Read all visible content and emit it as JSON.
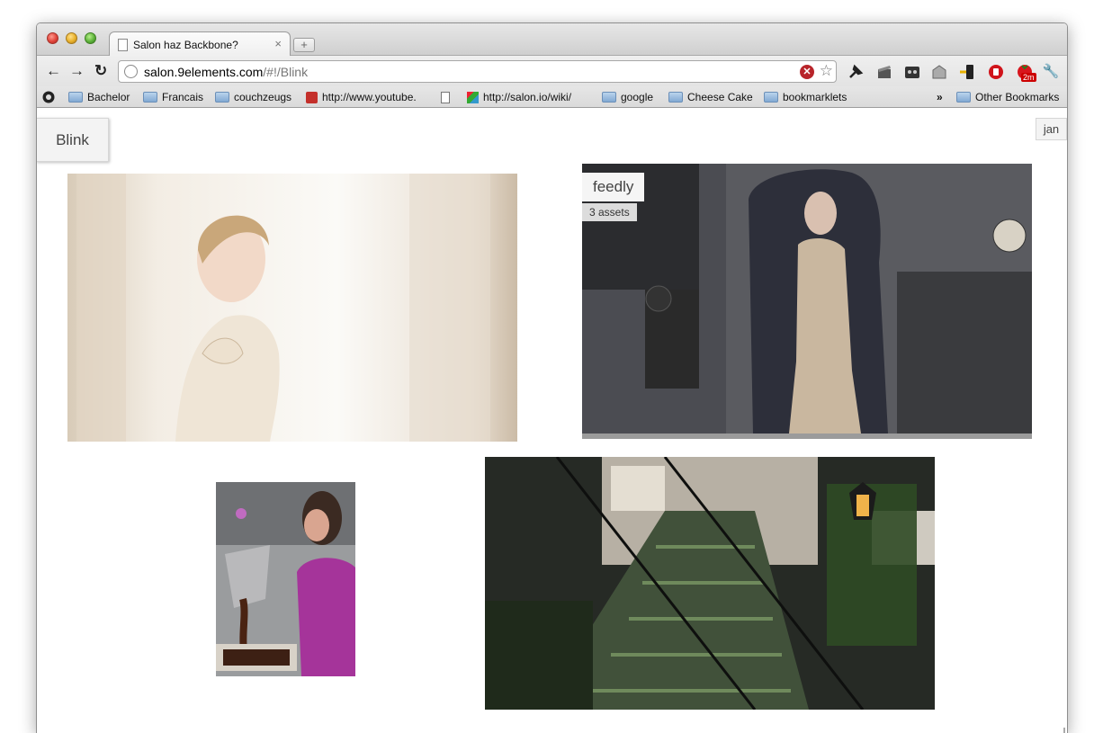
{
  "browser": {
    "tab_title": "Salon haz Backbone?",
    "tab_close": "×",
    "new_tab": "+",
    "url_host": "salon.9elements.com",
    "url_path": "/#!/Blink",
    "nav": {
      "back": "←",
      "forward": "→",
      "reload": "↻"
    },
    "stop_icon": "✕",
    "star_icon": "☆",
    "extension_badge": "2m",
    "wrench": "🔧"
  },
  "bookmarks": {
    "items": [
      {
        "label": "Bachelor",
        "icon": "folder-icon"
      },
      {
        "label": "Francais",
        "icon": "folder-icon"
      },
      {
        "label": "couchzeugs",
        "icon": "folder-icon"
      },
      {
        "label": "http://www.youtube.",
        "icon": "youtube-icon"
      },
      {
        "label": "",
        "icon": "page-icon"
      },
      {
        "label": "http://salon.io/wiki/",
        "icon": "salon-icon"
      },
      {
        "label": "google",
        "icon": "folder-icon"
      },
      {
        "label": "Cheese Cake",
        "icon": "folder-icon"
      },
      {
        "label": "bookmarklets",
        "icon": "folder-icon"
      }
    ],
    "overflow": "»",
    "other": "Other Bookmarks"
  },
  "page": {
    "collection_tab": "Blink",
    "user_tab": "jan",
    "feedly_label": "feedly",
    "assets_count": "3 assets"
  },
  "colors": {
    "photo_bright": "#efe7dc",
    "photo_dark": "#3a3a3e",
    "photo_kitchen": "#8a6a70",
    "photo_stairs": "#2f3a2a"
  }
}
